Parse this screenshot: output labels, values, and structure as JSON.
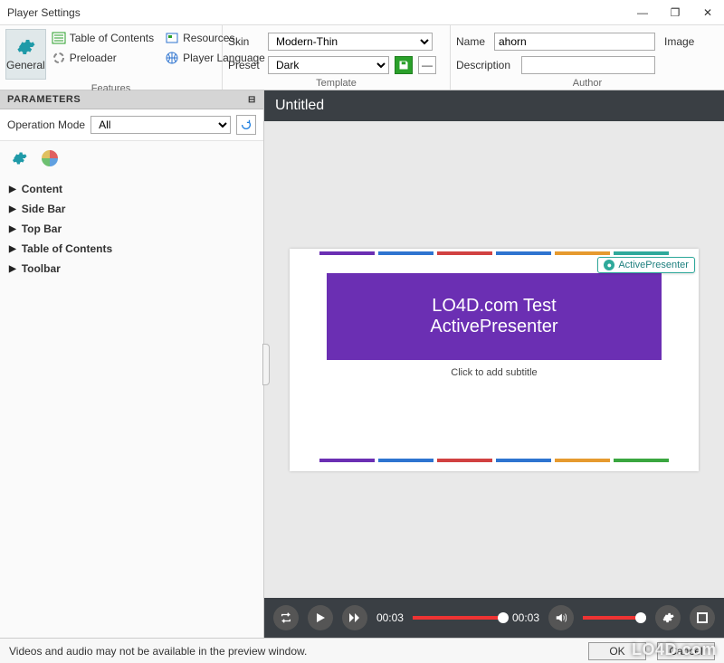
{
  "window": {
    "title": "Player Settings",
    "minimize": "—",
    "maximize": "❐",
    "close": "✕"
  },
  "ribbon": {
    "general": {
      "label": "General",
      "icon": "gear-icon"
    },
    "features": {
      "group_label": "Features",
      "items": [
        {
          "label": "Table of Contents",
          "icon": "toc-icon"
        },
        {
          "label": "Preloader",
          "icon": "preloader-icon"
        },
        {
          "label": "Resources",
          "icon": "resources-icon"
        },
        {
          "label": "Player Language",
          "icon": "language-icon"
        }
      ]
    },
    "template": {
      "group_label": "Template",
      "skin_label": "Skin",
      "skin_value": "Modern-Thin",
      "preset_label": "Preset",
      "preset_value": "Dark",
      "save_icon": "save-icon",
      "remove_label": "—"
    },
    "author": {
      "group_label": "Author",
      "name_label": "Name",
      "name_value": "ahorn",
      "desc_label": "Description",
      "desc_value": "",
      "image_label": "Image"
    }
  },
  "parameters": {
    "title": "PARAMETERS",
    "opmode_label": "Operation Mode",
    "opmode_value": "All",
    "tree": [
      "Content",
      "Side Bar",
      "Top Bar",
      "Table of Contents",
      "Toolbar"
    ]
  },
  "preview": {
    "title": "Untitled",
    "slide_title_l1": "LO4D.com Test",
    "slide_title_l2": "ActivePresenter",
    "slide_subtitle": "Click to add subtitle",
    "badge": "ActivePresenter"
  },
  "player": {
    "time_current": "00:03",
    "time_total": "00:03",
    "seek_pct": 100,
    "vol_pct": 92
  },
  "footer": {
    "message": "Videos and audio may not be available in the preview window.",
    "ok": "OK",
    "cancel": "Cancel"
  },
  "watermark": "LO4D.com"
}
